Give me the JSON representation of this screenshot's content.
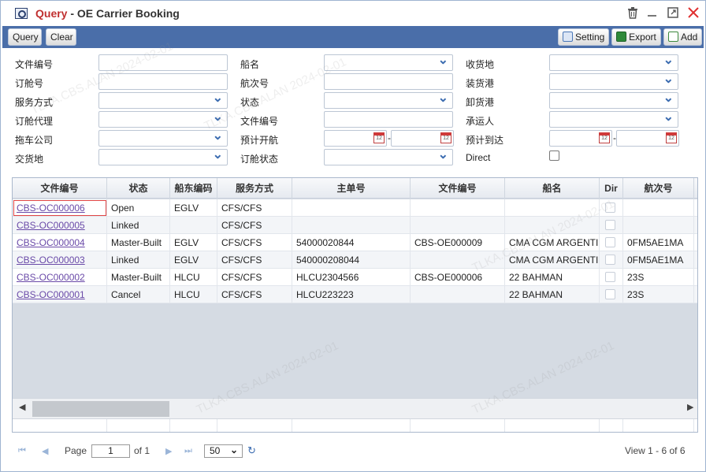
{
  "window": {
    "title_prefix": "Query",
    "title_sep": " - ",
    "title_main": "OE Carrier Booking",
    "icons": [
      "query-icon",
      "trash-icon",
      "minimize-icon",
      "maximize-icon",
      "close-icon"
    ]
  },
  "toolbar": {
    "query_label": "Query",
    "clear_label": "Clear",
    "setting_label": "Setting",
    "export_label": "Export",
    "add_label": "Add"
  },
  "form": {
    "doc_no_label": "文件编号",
    "booking_no_label": "订舱号",
    "service_mode_label": "服务方式",
    "booking_agent_label": "订舱代理",
    "trucking_label": "拖车公司",
    "delivery_label": "交货地",
    "vessel_label": "船名",
    "voyage_label": "航次号",
    "status_label": "状态",
    "doc_no2_label": "文件编号",
    "etd_label": "预计开航",
    "booking_status_label": "订舱状态",
    "receipt_label": "收货地",
    "pol_label": "装货港",
    "pod_label": "卸货港",
    "carrier_label": "承运人",
    "eta_label": "预计到达",
    "direct_label": "Direct",
    "date_sep": "-",
    "cal_day": "12"
  },
  "grid": {
    "columns": [
      "文件编号",
      "状态",
      "船东编码",
      "服务方式",
      "主单号",
      "文件编号",
      "船名",
      "Dir",
      "航次号"
    ],
    "rows": [
      {
        "doc": "CBS-OC000006",
        "status": "Open",
        "owner": "EGLV",
        "service": "CFS/CFS",
        "mbl": "",
        "file": "",
        "vessel": "",
        "voyage": ""
      },
      {
        "doc": "CBS-OC000005",
        "status": "Linked",
        "owner": "",
        "service": "CFS/CFS",
        "mbl": "",
        "file": "",
        "vessel": "",
        "voyage": ""
      },
      {
        "doc": "CBS-OC000004",
        "status": "Master-Built",
        "owner": "EGLV",
        "service": "CFS/CFS",
        "mbl": "54000020844",
        "file": "CBS-OE000009",
        "vessel": "CMA CGM ARGENTINA",
        "voyage": "0FM5AE1MA"
      },
      {
        "doc": "CBS-OC000003",
        "status": "Linked",
        "owner": "EGLV",
        "service": "CFS/CFS",
        "mbl": "540000208044",
        "file": "",
        "vessel": "CMA CGM ARGENTINA",
        "voyage": "0FM5AE1MA"
      },
      {
        "doc": "CBS-OC000002",
        "status": "Master-Built",
        "owner": "HLCU",
        "service": "CFS/CFS",
        "mbl": "HLCU2304566",
        "file": "CBS-OE000006",
        "vessel": "22 BAHMAN",
        "voyage": "23S"
      },
      {
        "doc": "CBS-OC000001",
        "status": "Cancel",
        "owner": "HLCU",
        "service": "CFS/CFS",
        "mbl": "HLCU223223",
        "file": "",
        "vessel": "22 BAHMAN",
        "voyage": "23S"
      }
    ]
  },
  "pager": {
    "page_label": "Page",
    "page_value": "1",
    "of_label": "of 1",
    "page_size": "50",
    "view_text": "View 1 - 6 of 6"
  },
  "watermark": "TLKA.CBS.ALAN 2024-02-01"
}
